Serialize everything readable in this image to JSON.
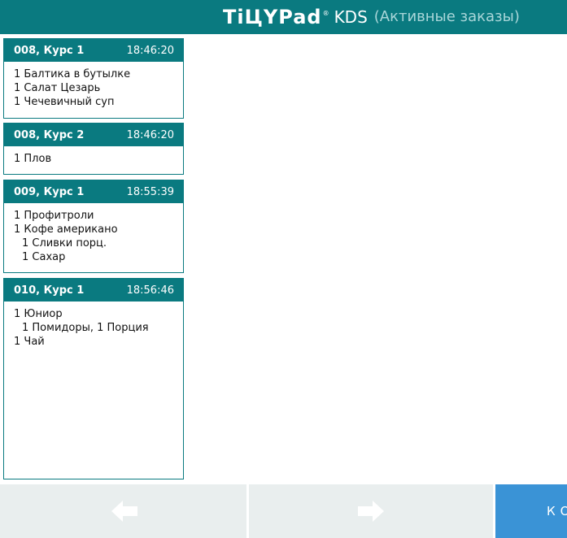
{
  "header": {
    "logo_mark": "TiЦYPad",
    "logo_reg": "®",
    "product": "KDS",
    "screen": "(Активные заказы)"
  },
  "orders": [
    {
      "title": "008, Курс 1",
      "time": "18:46:20",
      "lines": [
        "1 Балтика в бутылке",
        "1 Салат Цезарь",
        "1 Чечевичный суп"
      ]
    },
    {
      "title": "008, Курс 2",
      "time": "18:46:20",
      "lines": [
        "1 Плов"
      ]
    },
    {
      "title": "009, Курс 1",
      "time": "18:55:39",
      "lines": [
        "1 Профитроли",
        "1 Кофе американо",
        "1 Сливки порц.",
        "1 Сахар"
      ]
    },
    {
      "title": "010, Курс 1",
      "time": "18:56:46",
      "lines": [
        "1 Юниор",
        "1 Помидоры, 1 Порция",
        "1 Чай"
      ]
    }
  ],
  "footer": {
    "prev_icon": "arrow-left-icon",
    "next_icon": "arrow-right-icon",
    "complete_label": "КО"
  },
  "colors": {
    "header": "#0a7a80",
    "nav_button": "#e9eeee",
    "complete_button": "#3a93d6"
  }
}
